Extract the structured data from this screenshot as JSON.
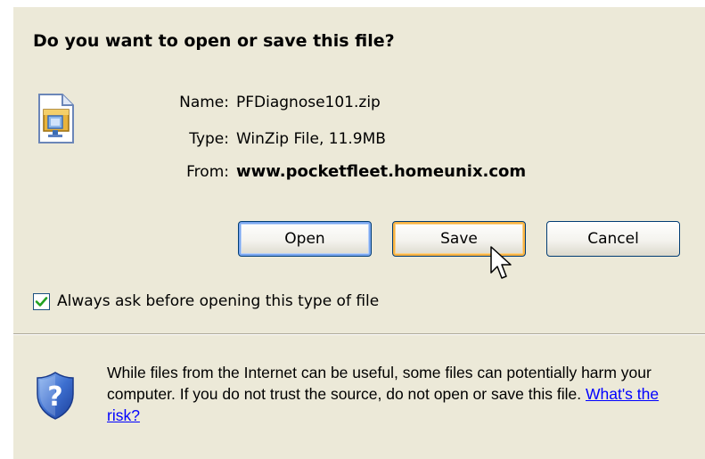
{
  "dialog": {
    "title": "Do you want to open or save this file?",
    "file_icon": "zip-file-icon",
    "fields": [
      {
        "label": "Name:",
        "value": "PFDiagnose101.zip"
      },
      {
        "label": "Type:",
        "value": "WinZip File, 11.9MB"
      },
      {
        "label": "From:",
        "value": "www.pocketfleet.homeunix.com"
      }
    ],
    "buttons": {
      "open": "Open",
      "save": "Save",
      "cancel": "Cancel"
    },
    "checkbox": {
      "label": "Always ask before opening this type of file",
      "checked": true
    },
    "warning": {
      "icon": "security-shield-question-icon",
      "text": "While files from the Internet can be useful, some files can potentially harm your computer. If you do not trust the source, do not open or save this file.",
      "link": "What's the risk?"
    }
  },
  "colors": {
    "dialog_bg": "#ece9d8",
    "button_border": "#003c74",
    "focus_orange": "#f8b343",
    "default_blue": "#7aa7f0",
    "checkmark_green": "#21a121",
    "link_blue": "#0000ff"
  }
}
